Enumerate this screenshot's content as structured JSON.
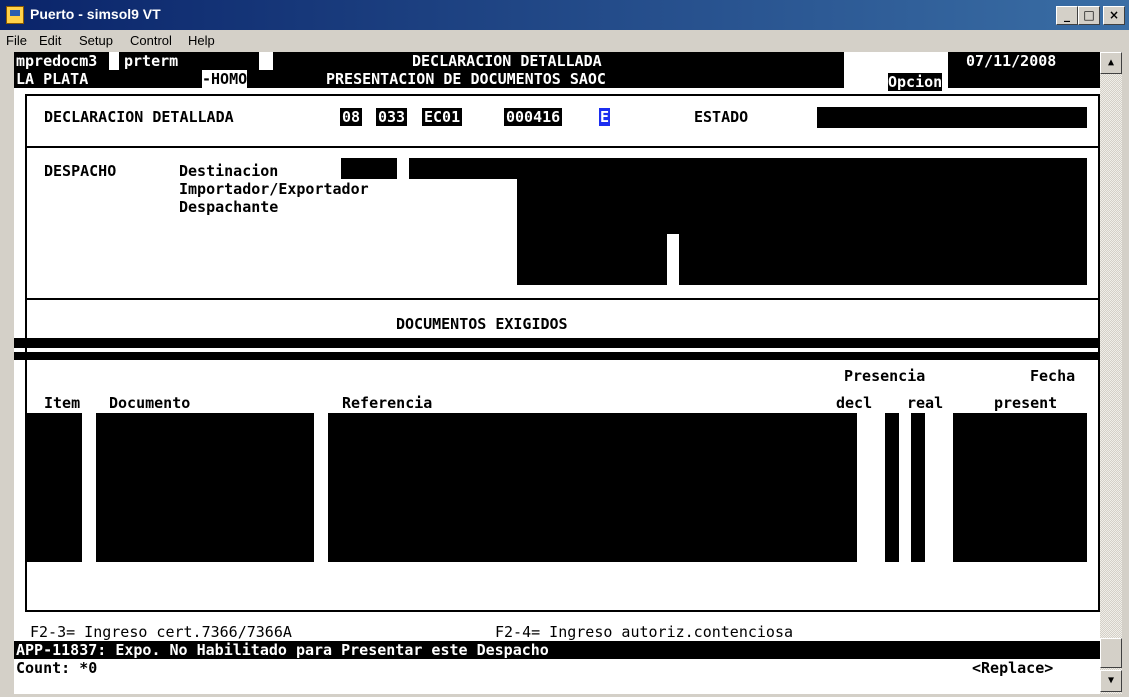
{
  "window": {
    "title": "Puerto - simsol9 VT",
    "controls": {
      "minimize": "_",
      "maximize": "□",
      "close": "×"
    }
  },
  "menu": [
    "File",
    "Edit",
    "Setup",
    "Control",
    "Help"
  ],
  "header": {
    "program": "mpredocm3",
    "terminal": "prterm",
    "screen_title": "DECLARACION DETALLADA",
    "date": "07/11/2008",
    "location": "LA PLATA",
    "env": "-HOMO",
    "screen_subtitle": "PRESENTACION DE DOCUMENTOS SAOC",
    "option_label": "Opcion"
  },
  "declaracion": {
    "label": "DECLARACION DETALLADA",
    "year": "08",
    "aduana": "033",
    "type": "EC01",
    "number": "000416",
    "check": "E",
    "estado_label": "ESTADO"
  },
  "despacho": {
    "label": "DESPACHO",
    "destinacion_label": "Destinacion",
    "importador_label": "Importador/Exportador",
    "despachante_label": "Despachante"
  },
  "documentos": {
    "section_title": "DOCUMENTOS EXIGIDOS",
    "col_item": "Item",
    "col_documento": "Documento",
    "col_referencia": "Referencia",
    "col_presencia": "Presencia",
    "col_decl": "decl",
    "col_real": "real",
    "col_fecha": "Fecha",
    "col_present": "present"
  },
  "function_keys": {
    "f23": "F2-3= Ingreso cert.7366/7366A",
    "f24": "F2-4= Ingreso autoriz.contenciosa"
  },
  "status": {
    "message": "APP-11837: Expo. No Habilitado para Presentar este Despacho",
    "count": "Count: *0",
    "mode": "<Replace>"
  },
  "icons": {
    "app": "terminal-app-icon",
    "scroll_up": "scroll-up-arrow-icon",
    "scroll_down": "scroll-down-arrow-icon"
  }
}
